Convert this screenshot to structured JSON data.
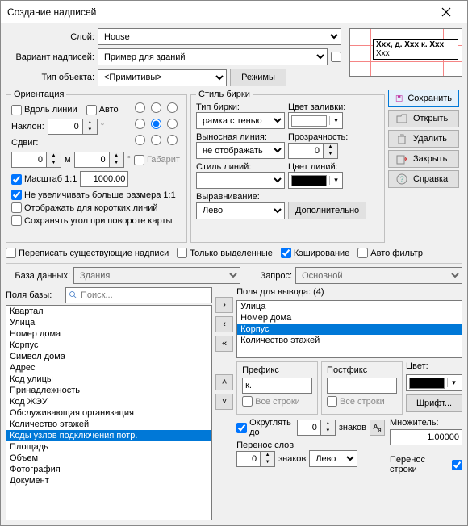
{
  "title": "Создание надписей",
  "top": {
    "layer_label": "Слой:",
    "layer_value": "House",
    "variant_label": "Вариант надписей:",
    "variant_value": "Пример для зданий",
    "objtype_label": "Тип объекта:",
    "objtype_value": "<Примитивы>",
    "modes_btn": "Режимы"
  },
  "preview": {
    "line1": "Xxx, д. Xxx к. Xxx",
    "line2": "Xxx"
  },
  "orientation": {
    "legend": "Ориентация",
    "along": "Вдоль линии",
    "auto": "Авто",
    "slope": "Наклон:",
    "slope_val": "0",
    "shift": "Сдвиг:",
    "shift_x": "0",
    "shift_y": "0",
    "m": "м",
    "gabarit": "Габарит",
    "scale11": "Масштаб 1:1",
    "scale_val": "1000.00",
    "noenlarge": "Не увеличивать больше размера 1:1",
    "shortlines": "Отображать для коротких линий",
    "keepangle": "Сохранять угол при повороте карты"
  },
  "tagstyle": {
    "legend": "Стиль бирки",
    "tagtype": "Тип бирки:",
    "tagtype_val": "рамка с тенью",
    "fillcolor": "Цвет заливки:",
    "leader": "Выносная линия:",
    "leader_val": "не отображать",
    "transp": "Прозрачность:",
    "transp_val": "0",
    "linestyle": "Стиль линий:",
    "linecolor": "Цвет линий:",
    "align": "Выравнивание:",
    "align_val": "Лево",
    "more": "Дополнительно"
  },
  "sidebtns": {
    "save": "Сохранить",
    "open": "Открыть",
    "delete": "Удалить",
    "close": "Закрыть",
    "help": "Справка"
  },
  "opts": {
    "overwrite": "Переписать существующие надписи",
    "selonly": "Только выделенные",
    "cache": "Кэширование",
    "autofilt": "Авто фильтр"
  },
  "db": {
    "label": "База данных:",
    "value": "Здания",
    "query_label": "Запрос:",
    "query_value": "Основной"
  },
  "basefields": {
    "label": "Поля базы:",
    "search_ph": "Поиск...",
    "items": [
      "Квартал",
      "Улица",
      "Номер дома",
      "Корпус",
      "Символ дома",
      "Адрес",
      "Код улицы",
      "Принадлежность",
      "Код ЖЭУ",
      "Обслуживающая организация",
      "Количество этажей",
      "Коды узлов подключения потр.",
      "Площадь",
      "Объем",
      "Фотография",
      "Документ"
    ],
    "selected": 11
  },
  "outfields": {
    "label": "Поля для вывода: (4)",
    "items": [
      "Улица",
      "Номер дома",
      "Корпус",
      "Количество этажей"
    ],
    "selected": 2
  },
  "boxes": {
    "prefix": "Префикс",
    "prefix_val": "к.",
    "postfix": "Постфикс",
    "postfix_val": "",
    "allrows": "Все строки",
    "color": "Цвет:",
    "font": "Шрифт...",
    "round": "Округлять до",
    "round_val": "0",
    "round_after": "знаков",
    "mult": "Множитель:",
    "mult_val": "1.00000",
    "wrap": "Перенос слов",
    "wrap_val": "0",
    "wrap_after": "знаков",
    "wrap_align": "Лево",
    "linewrap": "Перенос строки"
  }
}
